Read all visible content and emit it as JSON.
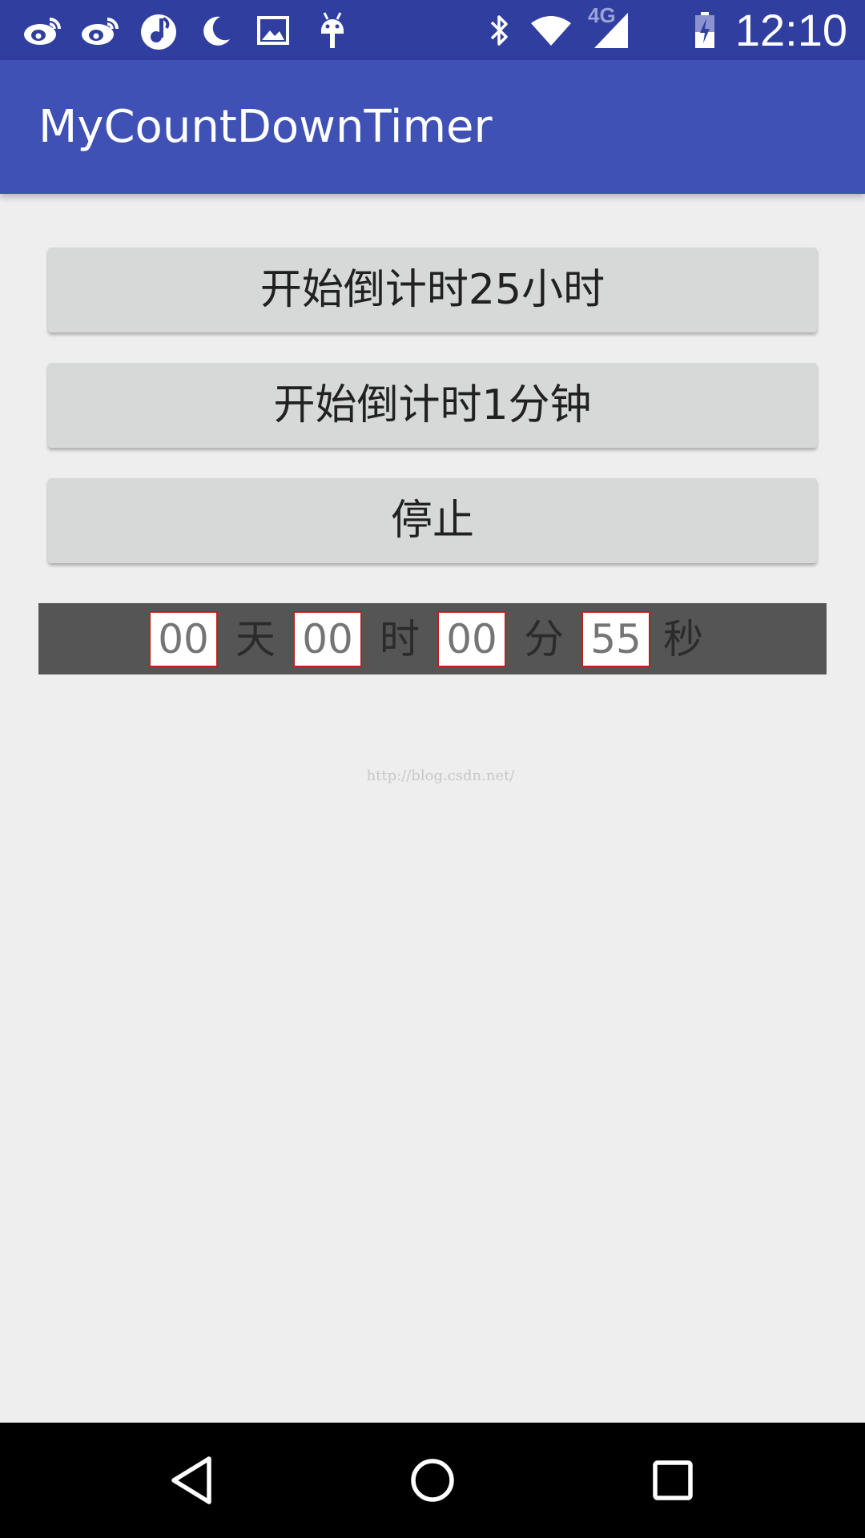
{
  "status_bar": {
    "time": "12:10",
    "network_label": "4G",
    "icons": [
      "weibo-icon",
      "weibo-icon",
      "music-app-icon",
      "moon-icon",
      "image-icon",
      "android-debug-icon",
      "bluetooth-icon",
      "wifi-icon",
      "cell-signal-icon",
      "battery-charging-icon"
    ]
  },
  "app_bar": {
    "title": "MyCountDownTimer"
  },
  "buttons": {
    "start_25h": "开始倒计时25小时",
    "start_1m": "开始倒计时1分钟",
    "stop": "停止"
  },
  "countdown": {
    "days": "00",
    "days_unit": "天",
    "hours": "00",
    "hours_unit": "时",
    "minutes": "00",
    "minutes_unit": "分",
    "seconds": "55",
    "seconds_unit": "秒"
  },
  "watermark": "http://blog.csdn.net/",
  "navigation": {
    "icons": [
      "back-icon",
      "home-icon",
      "recents-icon"
    ]
  },
  "colors": {
    "status_bar": "#303f9f",
    "app_bar": "#3f51b5",
    "background": "#eeeeee",
    "button": "#d7d8d8",
    "countdown_bg": "#555555",
    "countdown_border": "#c21f1f"
  }
}
